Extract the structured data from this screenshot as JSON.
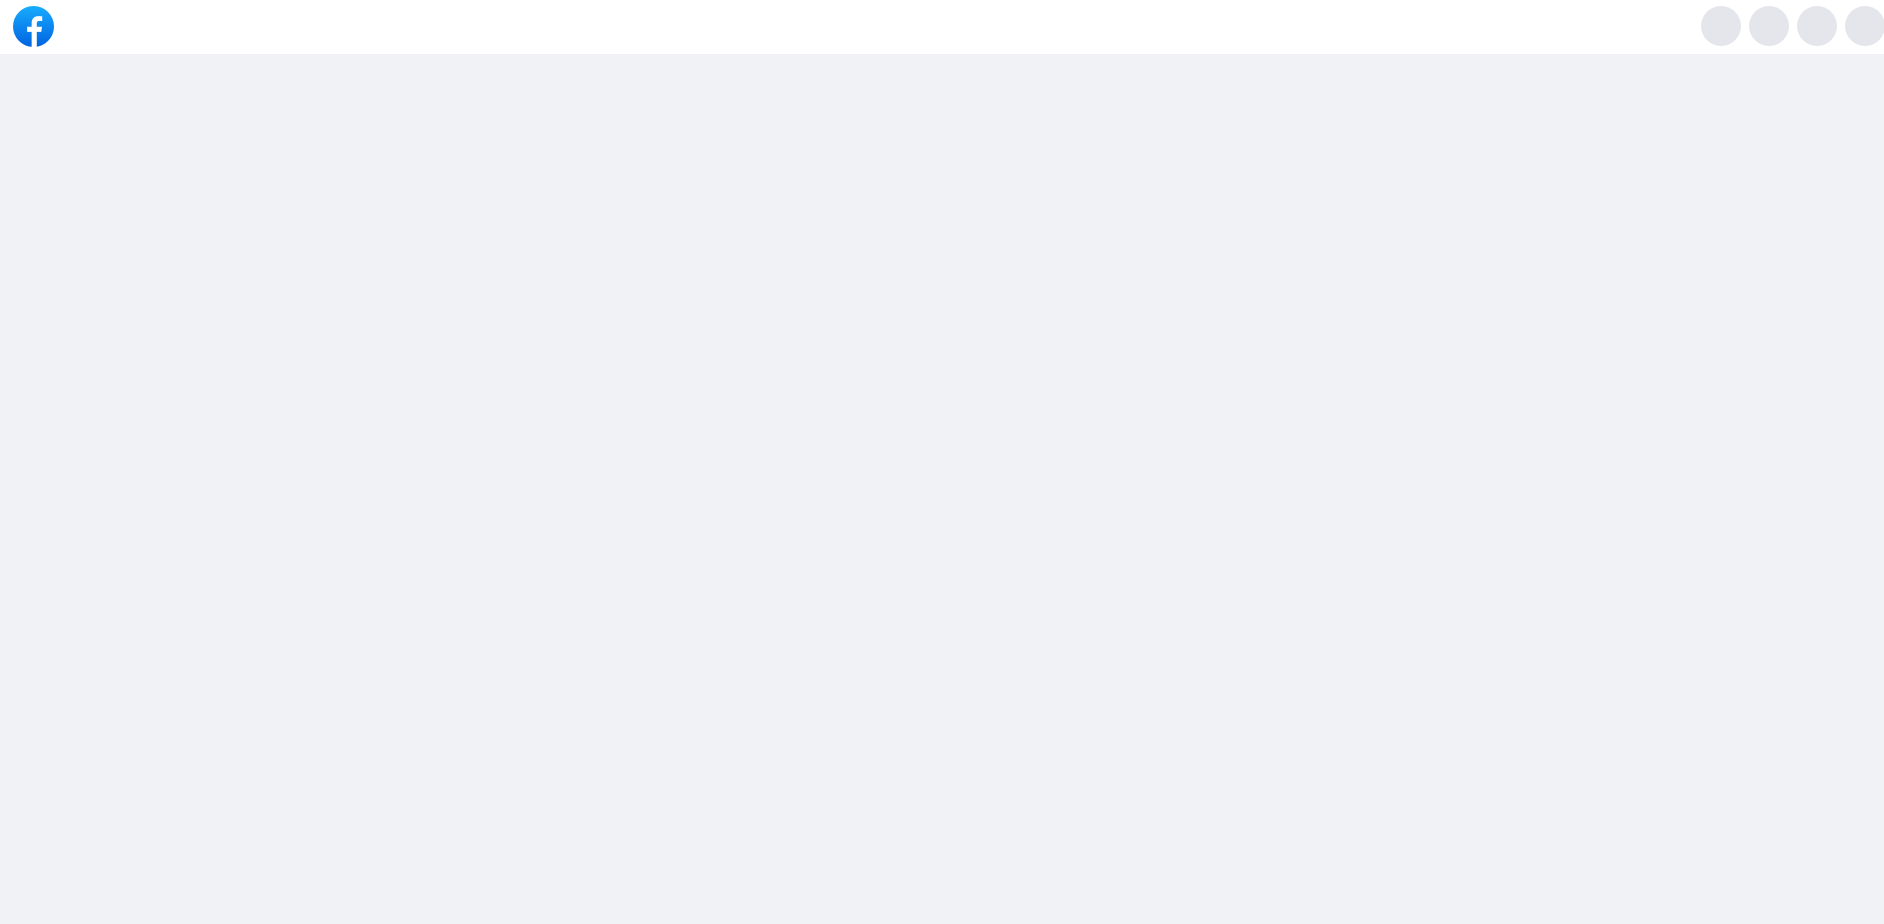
{
  "header": {
    "logo_icon": "facebook-logo-icon",
    "brand_color": "#1877f2",
    "actions": [
      {
        "icon": "loading-placeholder-icon"
      },
      {
        "icon": "loading-placeholder-icon"
      },
      {
        "icon": "loading-placeholder-icon"
      },
      {
        "icon": "loading-placeholder-icon"
      }
    ],
    "placeholder_color": "#e4e6eb"
  },
  "page": {
    "background_color": "#f0f2f5"
  }
}
